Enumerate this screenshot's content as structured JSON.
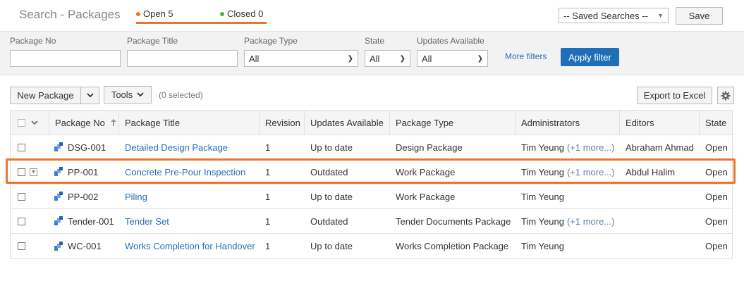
{
  "header": {
    "title": "Search - Packages",
    "open_tab": "Open 5",
    "closed_tab": "Closed 0",
    "saved_searches": "-- Saved Searches --",
    "save_label": "Save"
  },
  "filters": {
    "package_no_label": "Package No",
    "package_title_label": "Package Title",
    "package_type_label": "Package Type",
    "package_type_value": "All",
    "state_label": "State",
    "state_value": "All",
    "updates_label": "Updates Available",
    "updates_value": "All",
    "more_filters": "More filters",
    "apply_filter": "Apply filter"
  },
  "toolbar": {
    "new_package": "New Package",
    "tools": "Tools",
    "selected": "(0 selected)",
    "export": "Export to Excel"
  },
  "table": {
    "columns": [
      "Package No",
      "Package Title",
      "Revision",
      "Updates Available",
      "Package Type",
      "Administrators",
      "Editors",
      "State"
    ],
    "rows": [
      {
        "no": "DSG-001",
        "title": "Detailed Design Package",
        "rev": "1",
        "updates": "Up to date",
        "type": "Design Package",
        "admin": "Tim Yeung",
        "more": "(+1 more...)",
        "editors": "Abraham Ahmad",
        "state": "Open"
      },
      {
        "no": "PP-001",
        "title": "Concrete Pre-Pour Inspection",
        "rev": "1",
        "updates": "Outdated",
        "type": "Work Package",
        "admin": "Tim Yeung",
        "more": "(+1 more...)",
        "editors": "Abdul Halim",
        "state": "Open"
      },
      {
        "no": "PP-002",
        "title": "Piling",
        "rev": "1",
        "updates": "Up to date",
        "type": "Work Package",
        "admin": "Tim Yeung",
        "more": "",
        "editors": "",
        "state": "Open"
      },
      {
        "no": "Tender-001",
        "title": "Tender Set",
        "rev": "1",
        "updates": "Outdated",
        "type": "Tender Documents Package",
        "admin": "Tim Yeung",
        "more": "(+1 more...)",
        "editors": "",
        "state": "Open"
      },
      {
        "no": "WC-001",
        "title": "Works Completion for Handover",
        "rev": "1",
        "updates": "Up to date",
        "type": "Works Completion Package",
        "admin": "Tim Yeung",
        "more": "",
        "editors": "",
        "state": "Open"
      }
    ]
  },
  "colors": {
    "accent": "#e8772e",
    "open_dot": "#e8772e",
    "closed_dot": "#4caf50",
    "primary": "#1f6fb8",
    "link": "#2a6db5"
  },
  "icons": {
    "package": "package-icon",
    "sort": "sort-up-icon",
    "settings": "gear-icon",
    "caret": "chevron-down-icon"
  }
}
